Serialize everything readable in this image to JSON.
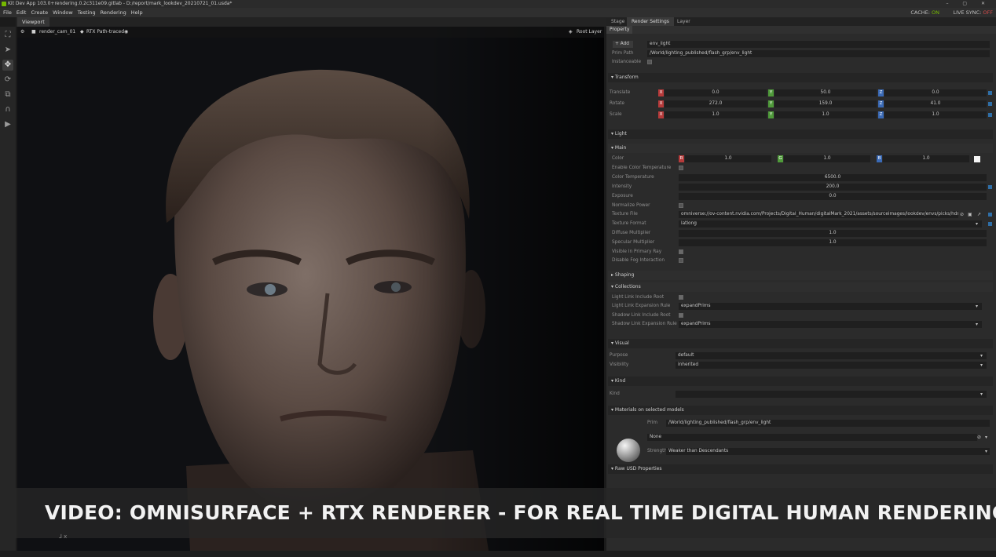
{
  "app": {
    "title": "Kit Dev App 103.0+rendering.0.2c311e09.gitlab - D:/report/mark_lookdev_20210721_01.usda*",
    "window_controls": "– ▢ ✕"
  },
  "menu": {
    "items": [
      "File",
      "Edit",
      "Create",
      "Window",
      "Testing",
      "Rendering",
      "Help"
    ],
    "cache_label": "CACHE:",
    "cache_state": "ON",
    "live_sync_label": "LIVE SYNC:",
    "live_sync_state": "OFF"
  },
  "toolbar": {
    "tools": [
      "select-icon",
      "arrow-icon",
      "move-icon",
      "rotate-icon",
      "scale-icon",
      "snap-icon",
      "play-icon"
    ]
  },
  "viewport": {
    "tab_label": "Viewport",
    "camera": "render_cam_01",
    "render_mode": "RTX Path-traced",
    "layer": "Root Layer",
    "axis": "x"
  },
  "banner": {
    "text": "VIDEO: OMNISURFACE + RTX RENDERER - FOR REAL TIME DIGITAL HUMAN RENDERING"
  },
  "right_tabs": [
    "Stage",
    "Render Settings",
    "Layer"
  ],
  "property_tab": "Property",
  "property": {
    "add_label": "Add",
    "name_value": "env_light",
    "prim_path_label": "Prim Path",
    "prim_path_value": "/World/lighting_published/flash_grp/env_light",
    "instanceable_label": "Instanceable"
  },
  "transform": {
    "header": "Transform",
    "translate_label": "Translate",
    "rotate_label": "Rotate",
    "scale_label": "Scale",
    "translate": [
      "0.0",
      "50.0",
      "0.0"
    ],
    "rotate": [
      "272.0",
      "159.0",
      "41.0"
    ],
    "scale": [
      "1.0",
      "1.0",
      "1.0"
    ]
  },
  "light": {
    "header": "Light",
    "main_header": "Main",
    "color_label": "Color",
    "color": [
      "1.0",
      "1.0",
      "1.0"
    ],
    "enable_color_temp_label": "Enable Color Temperature",
    "color_temp_label": "Color Temperature",
    "color_temp_value": "6500.0",
    "intensity_label": "Intensity",
    "intensity_value": "200.0",
    "exposure_label": "Exposure",
    "exposure_value": "0.0",
    "normalize_label": "Normalize Power",
    "texture_file_label": "Texture File",
    "texture_file_value": "omniverse://ov-content.nvidia.com/Projects/Digital_Human/digitalMark_2021/assets/sourceimages/lookdev/envs/picks/hdrihaven",
    "texture_format_label": "Texture Format",
    "texture_format_value": "latlong",
    "diffuse_label": "Diffuse Multiplier",
    "diffuse_value": "1.0",
    "specular_label": "Specular Multiplier",
    "specular_value": "1.0",
    "visible_primary_label": "Visible In Primary Ray",
    "disable_fog_label": "Disable Fog Interaction",
    "shaping_header": "Shaping",
    "collections_header": "Collections",
    "link_include_label": "Light Link Include Root",
    "link_rule_label": "Light Link Expansion Rule",
    "link_rule_value": "expandPrims",
    "shadow_include_label": "Shadow Link Include Root",
    "shadow_rule_label": "Shadow Link Expansion Rule",
    "shadow_rule_value": "expandPrims"
  },
  "visual": {
    "header": "Visual",
    "purpose_label": "Purpose",
    "purpose_value": "default",
    "visibility_label": "Visibility",
    "visibility_value": "inherited"
  },
  "kind": {
    "header": "Kind",
    "kind_label": "Kind",
    "kind_value": ""
  },
  "materials": {
    "header": "Materials on selected models",
    "prim_label": "Prim",
    "prim_value": "/World/lighting_published/flash_grp/env_light",
    "material_value": "None",
    "strength_label": "Strength",
    "strength_value": "Weaker than Descendants"
  },
  "raw_usd": {
    "header": "Raw USD Properties"
  }
}
